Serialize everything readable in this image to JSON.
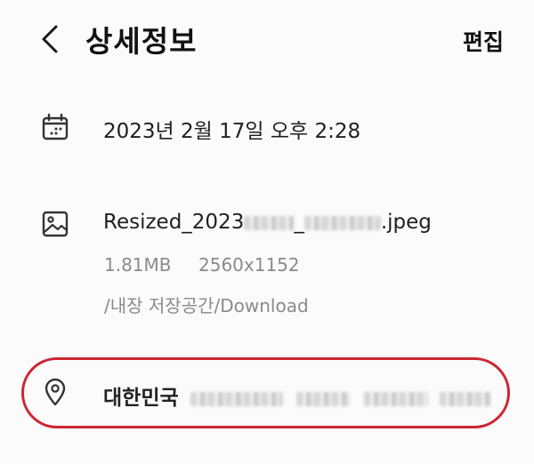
{
  "header": {
    "title": "상세정보",
    "edit_label": "편집"
  },
  "date_row": {
    "icon": "calendar-icon",
    "datetime": "2023년 2월 17일 오후 2:28"
  },
  "file_row": {
    "icon": "image-icon",
    "name_prefix": "Resized_2023",
    "name_separator": "_",
    "name_extension": ".jpeg",
    "size": "1.81MB",
    "resolution": "2560x1152",
    "path": "/내장 저장공간/Download"
  },
  "location_row": {
    "icon": "location-pin-icon",
    "country": "대한민국",
    "highlight_color": "#cc2630"
  }
}
